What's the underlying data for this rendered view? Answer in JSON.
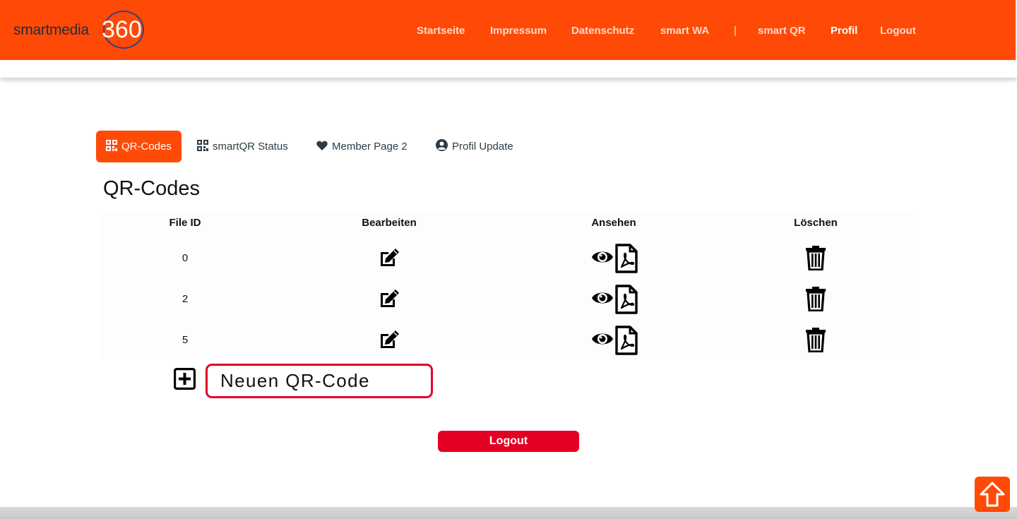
{
  "header": {
    "logo": {
      "word": "smartmedia",
      "number": "360"
    },
    "nav": [
      {
        "label": "Startseite"
      },
      {
        "label": "Impressum"
      },
      {
        "label": "Datenschutz"
      },
      {
        "label": "smart WA"
      },
      {
        "label": "|"
      },
      {
        "label": "smart QR"
      },
      {
        "label": "Profil",
        "active": true
      },
      {
        "label": "Logout"
      }
    ]
  },
  "tabs": [
    {
      "label": "QR-Codes",
      "icon": "qr-icon",
      "active": true
    },
    {
      "label": "smartQR Status",
      "icon": "qr-icon"
    },
    {
      "label": "Member Page 2",
      "icon": "heart-icon"
    },
    {
      "label": "Profil Update",
      "icon": "user-circle-icon"
    }
  ],
  "page_title": "QR-Codes",
  "table": {
    "columns": [
      "File ID",
      "Bearbeiten",
      "Ansehen",
      "Löschen"
    ],
    "rows": [
      {
        "file_id": "0"
      },
      {
        "file_id": "2"
      },
      {
        "file_id": "5"
      }
    ],
    "icons": {
      "edit": "edit-icon",
      "view": "eye-icon",
      "pdf": "pdf-icon",
      "delete": "trash-icon"
    }
  },
  "new_qr_label": "Neuen QR-Code",
  "logout_label": "Logout",
  "colors": {
    "brand": "#ff4a07",
    "red": "#e30022"
  }
}
